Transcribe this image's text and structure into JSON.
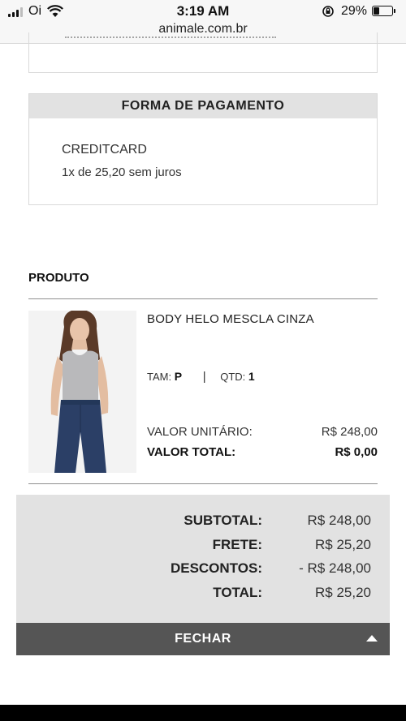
{
  "status_bar": {
    "carrier": "Oi",
    "time": "3:19 AM",
    "battery_percent": "29%",
    "icons": [
      "signal-icon",
      "wifi-icon",
      "rotation-lock-icon",
      "battery-icon"
    ]
  },
  "browser": {
    "url": "animale.com.br"
  },
  "payment": {
    "header": "FORMA DE PAGAMENTO",
    "method": "CREDITCARD",
    "installments": "1x de 25,20 sem juros"
  },
  "product_section": {
    "title": "PRODUTO",
    "item": {
      "name": "BODY HELO MESCLA CINZA",
      "size_label": "TAM:",
      "size_value": "P",
      "separator": "|",
      "qty_label": "QTD:",
      "qty_value": "1",
      "unit_price_label": "VALOR UNITÁRIO:",
      "unit_price_value": "R$ 248,00",
      "total_label": "VALOR TOTAL:",
      "total_value": "R$ 0,00"
    }
  },
  "summary": {
    "rows": [
      {
        "label": "SUBTOTAL:",
        "value": "R$ 248,00"
      },
      {
        "label": "FRETE:",
        "value": "R$ 25,20"
      },
      {
        "label": "DESCONTOS:",
        "value": "- R$ 248,00"
      },
      {
        "label": "TOTAL:",
        "value": "R$ 25,20"
      }
    ]
  },
  "close_button": {
    "label": "FECHAR",
    "icon": "chevron-up-icon"
  },
  "colors": {
    "header_gray": "#e2e2e2",
    "button_dark": "#555555",
    "border": "#d9d9d9"
  }
}
